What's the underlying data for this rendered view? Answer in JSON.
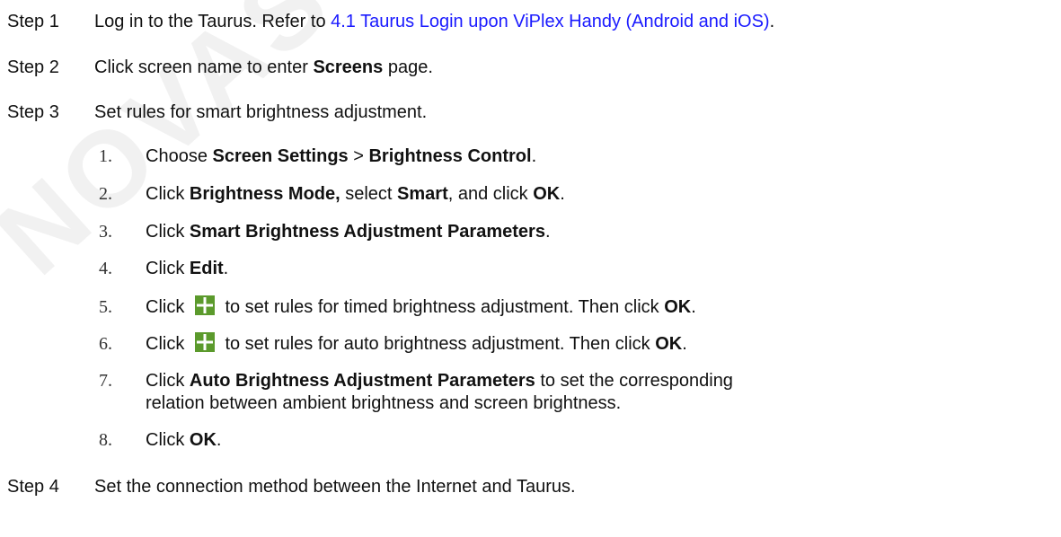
{
  "watermark": "NOVASTAR",
  "steps": [
    {
      "label": "Step 1",
      "text_before": "Log in to the Taurus. Refer to ",
      "link": "4.1 Taurus Login upon ViPlex Handy (Android and iOS)",
      "text_after": "."
    },
    {
      "label": "Step 2",
      "text_before": "Click screen name to enter ",
      "bold": "Screens",
      "text_after": " page."
    },
    {
      "label": "Step 3",
      "text": "Set rules for smart brightness adjustment."
    },
    {
      "label": "Step 4",
      "text": "Set the connection method between the Internet and Taurus."
    }
  ],
  "substeps": [
    {
      "num": "1.",
      "parts": [
        "Choose ",
        "Screen Settings",
        " > ",
        "Brightness Control",
        "."
      ]
    },
    {
      "num": "2.",
      "parts": [
        "Click ",
        "Brightness Mode,",
        " select ",
        "Smart",
        ", and click ",
        "OK",
        "."
      ]
    },
    {
      "num": "3.",
      "parts": [
        "Click ",
        "Smart Brightness Adjustment Parameters",
        "."
      ]
    },
    {
      "num": "4.",
      "parts": [
        "Click ",
        "Edit",
        "."
      ]
    },
    {
      "num": "5.",
      "before": "Click ",
      "icon": "plus-icon",
      "after": " to set rules for timed brightness adjustment. Then click ",
      "bold": "OK",
      "end": "."
    },
    {
      "num": "6.",
      "before": "Click ",
      "icon": "plus-icon",
      "after": " to set rules for auto brightness adjustment. Then click ",
      "bold": "OK",
      "end": "."
    },
    {
      "num": "7.",
      "line1_before": "Click ",
      "line1_bold": "Auto Brightness Adjustment Parameters",
      "line1_after": " to set the corresponding",
      "line2": "relation between ambient brightness and screen brightness."
    },
    {
      "num": "8.",
      "parts": [
        "Click ",
        "OK",
        "."
      ]
    }
  ],
  "colors": {
    "link": "#1a1aff",
    "icon_bg": "#5b9a2c",
    "watermark": "#f1f1f1"
  }
}
